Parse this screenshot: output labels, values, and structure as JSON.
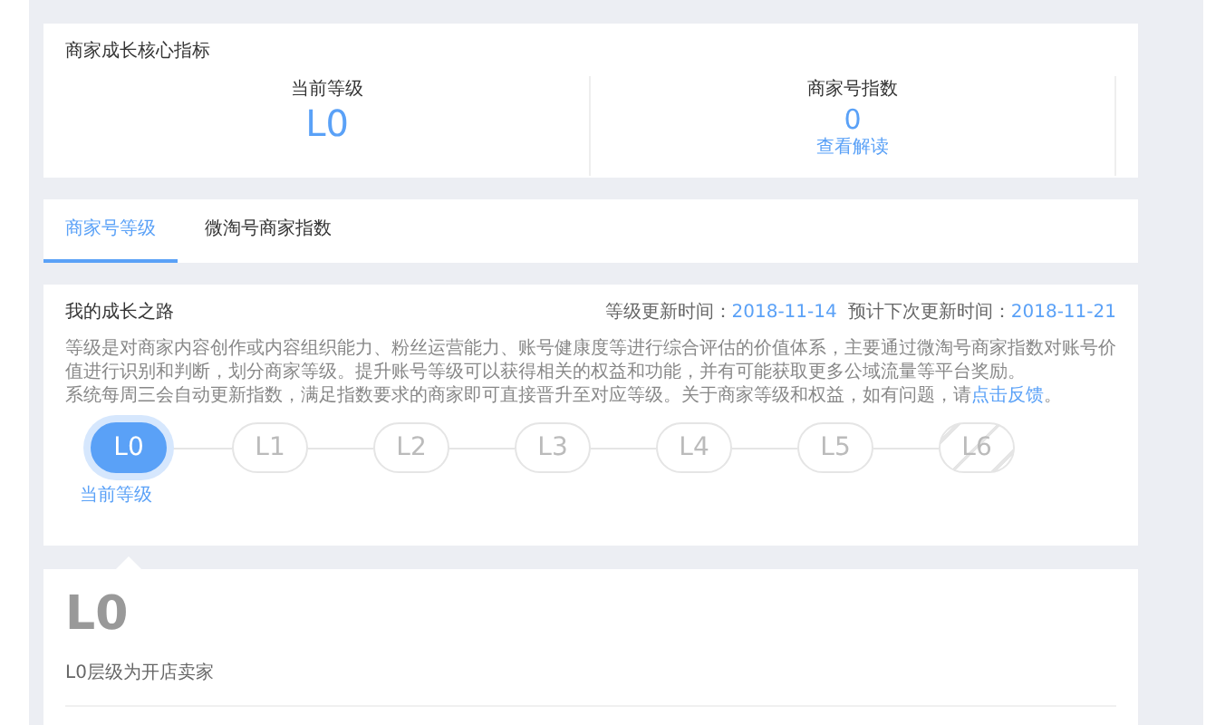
{
  "core_metrics": {
    "title": "商家成长核心指标",
    "metrics": [
      {
        "kind": "level",
        "label": "当前等级",
        "value": "L0"
      },
      {
        "kind": "index",
        "label": "商家号指数",
        "value": "0",
        "link": "查看解读"
      }
    ]
  },
  "tabs": [
    {
      "label": "商家号等级",
      "selected": true
    },
    {
      "label": "微淘号商家指数",
      "selected": false
    }
  ],
  "growth": {
    "title": "我的成长之路",
    "update_label": "等级更新时间：",
    "update_date": "2018-11-14",
    "next_label": "预计下次更新时间：",
    "next_date": "2018-11-21",
    "paragraphs": [
      "等级是对商家内容创作或内容组织能力、粉丝运营能力、账号健康度等进行综合评估的价值体系，主要通过微淘号商家指数对账号价值进行识别和判断，划分商家等级。提升账号等级可以获得相关的权益和功能，并有可能获取更多公域流量等平台奖励。",
      "系统每周三会自动更新指数，满足指数要求的商家即可直接晋升至对应等级。关于商家等级和权益，如有问题，请"
    ],
    "feedback_link": "点击反馈",
    "feedback_end": "。",
    "steps": [
      {
        "label": "L0",
        "selected": true,
        "locked": false
      },
      {
        "label": "L1",
        "selected": false,
        "locked": false
      },
      {
        "label": "L2",
        "selected": false,
        "locked": false
      },
      {
        "label": "L3",
        "selected": false,
        "locked": false
      },
      {
        "label": "L4",
        "selected": false,
        "locked": false
      },
      {
        "label": "L5",
        "selected": false,
        "locked": false
      },
      {
        "label": "L6",
        "selected": false,
        "locked": true
      }
    ],
    "current_label": "当前等级"
  },
  "detail": {
    "level": "L0",
    "description": "L0层级为开店卖家"
  }
}
